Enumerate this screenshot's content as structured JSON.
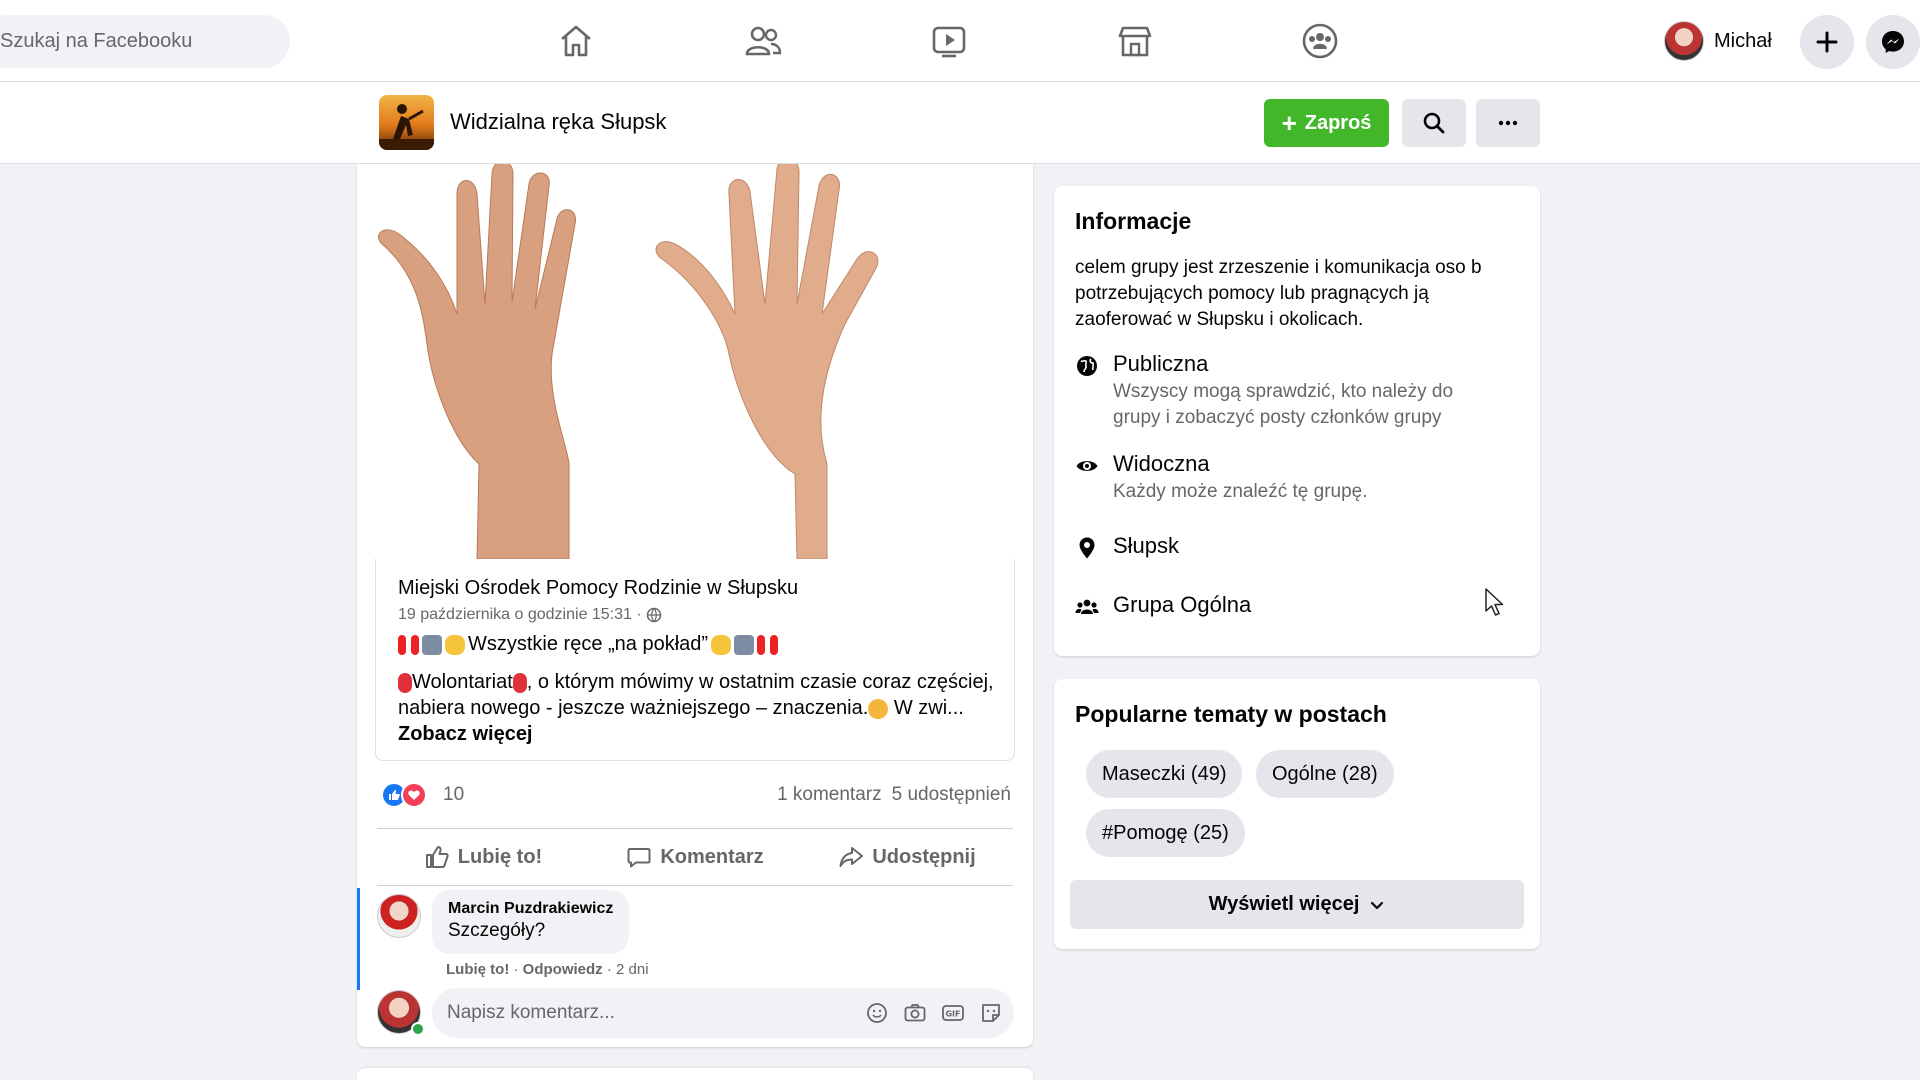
{
  "topnav": {
    "search_placeholder": "Szukaj na Facebooku",
    "user_name": "Michał",
    "icons": [
      "home-icon",
      "friends-icon",
      "watch-icon",
      "marketplace-icon",
      "groups-icon",
      "plus-icon",
      "messenger-icon"
    ]
  },
  "group": {
    "name": "Widzialna ręka Słupsk",
    "invite_label": "Zaproś"
  },
  "post": {
    "shared_author": "Miejski Ośrodek Pomocy Rodzinie w Słupsku",
    "shared_date": "19 października o godzinie 15:31 ·",
    "headline": "Wszystkie ręce „na pokład”",
    "body_prefix": "Wolontariat",
    "body_text": ", o którym mówimy w ostatnim czasie coraz częściej, nabiera nowego - jeszcze ważniejszego – znaczenia.",
    "body_suffix": " W zwi...",
    "see_more": "Zobacz więcej",
    "reaction_count": "10",
    "comments_count": "1 komentarz",
    "shares_count": "5 udostępnień",
    "actions": {
      "like": "Lubię to!",
      "comment": "Komentarz",
      "share": "Udostępnij"
    },
    "comment": {
      "author": "Marcin Puzdrakiewicz",
      "text": "Szczegóły?",
      "like": "Lubię to!",
      "reply": "Odpowiedz",
      "age": "2 dni"
    },
    "comment_placeholder": "Napisz komentarz..."
  },
  "info": {
    "title": "Informacje",
    "description": "celem grupy jest zrzeszenie i komunikacja oso b potrzebujących pomocy lub pragnących ją zaoferować w Słupsku i okolicach.",
    "items": [
      {
        "label": "Publiczna",
        "sub": "Wszyscy mogą sprawdzić, kto należy do grupy i zobaczyć posty członków grupy",
        "icon": "globe-icon"
      },
      {
        "label": "Widoczna",
        "sub": "Każdy może znaleźć tę grupę.",
        "icon": "eye-icon"
      },
      {
        "label": "Słupsk",
        "sub": "",
        "icon": "location-pin-icon"
      },
      {
        "label": "Grupa Ogólna",
        "sub": "",
        "icon": "people-icon"
      }
    ]
  },
  "topics": {
    "title": "Popularne tematy w postach",
    "chips": [
      "Maseczki (49)",
      "Ogólne (28)",
      "#Pomogę (25)"
    ],
    "show_more": "Wyświetl więcej"
  },
  "colors": {
    "accent_blue": "#1877f2",
    "invite_green": "#42b72a",
    "background": "#f0f2f5"
  }
}
